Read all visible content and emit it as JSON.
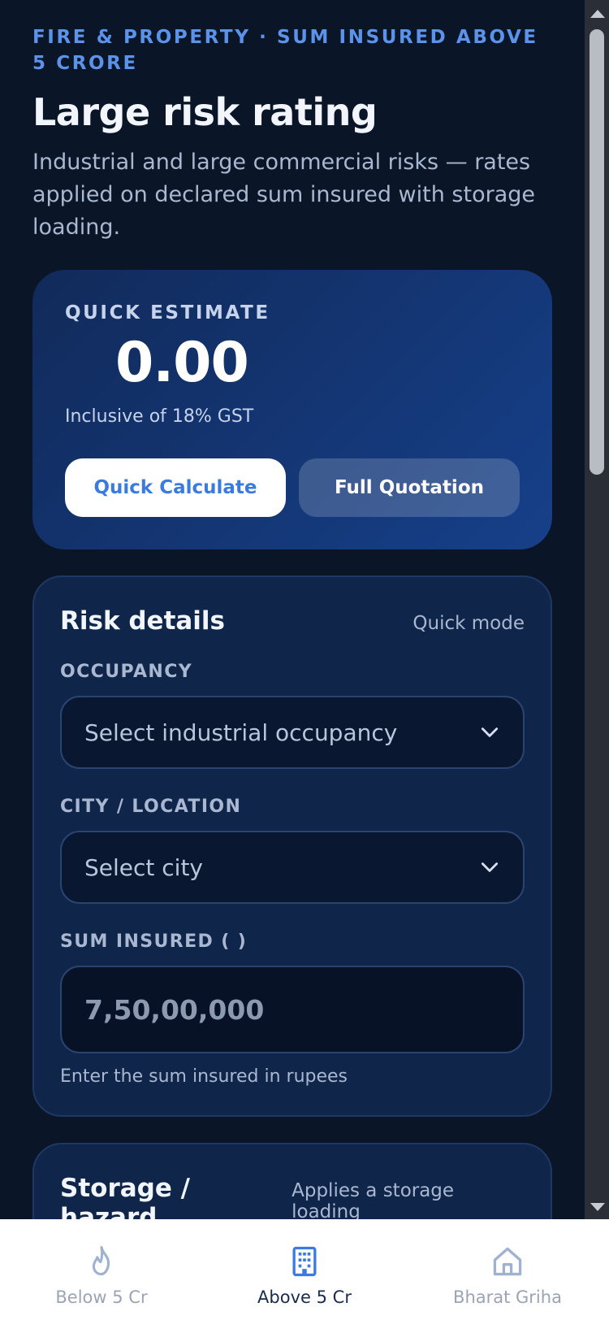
{
  "header": {
    "eyebrow": "FIRE & PROPERTY · SUM INSURED ABOVE   5 CRORE",
    "title": "Large risk rating",
    "description": "Industrial and large commercial risks — rates applied on declared sum insured with storage loading."
  },
  "estimate": {
    "label": "QUICK ESTIMATE",
    "value": "0.00",
    "note": "Inclusive of 18% GST",
    "quick_calculate_label": "Quick Calculate",
    "full_quotation_label": "Full Quotation"
  },
  "risk_details": {
    "title": "Risk details",
    "mode": "Quick mode",
    "occupancy_label": "OCCUPANCY",
    "occupancy_value": "Select industrial occupancy",
    "city_label": "CITY / LOCATION",
    "city_value": "Select city",
    "sum_label": "SUM INSURED (  )",
    "sum_placeholder": "7,50,00,000",
    "sum_help": "Enter the sum insured in rupees"
  },
  "storage": {
    "title": "Storage / hazard",
    "hint": "Applies a storage loading"
  },
  "nav": {
    "items": [
      {
        "label": "Below   5 Cr",
        "icon": "flame-icon",
        "active": false
      },
      {
        "label": "Above   5 Cr",
        "icon": "building-icon",
        "active": true
      },
      {
        "label": "Bharat Griha",
        "icon": "home-icon",
        "active": false
      }
    ]
  },
  "colors": {
    "background": "#0a1628",
    "accent": "#3a7be0",
    "card": "#10254a"
  }
}
